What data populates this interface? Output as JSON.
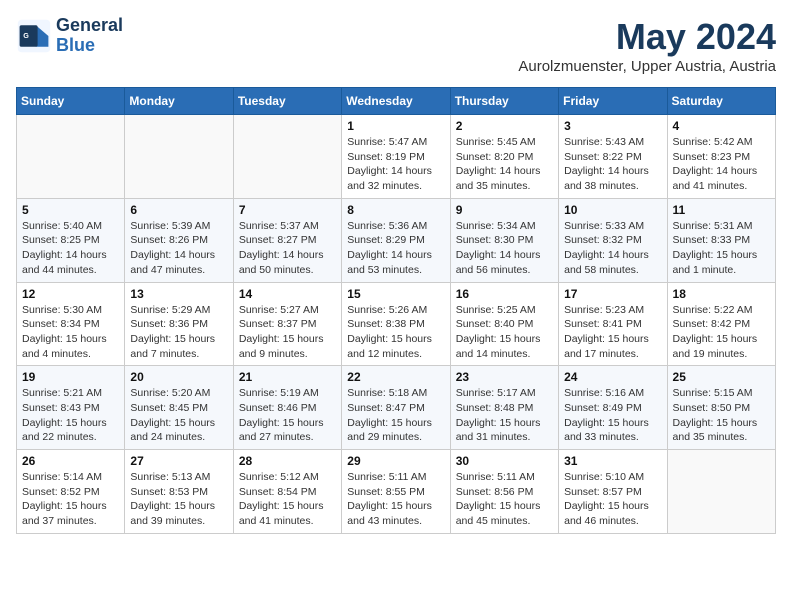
{
  "header": {
    "logo_line1": "General",
    "logo_line2": "Blue",
    "month": "May 2024",
    "location": "Aurolzmuenster, Upper Austria, Austria"
  },
  "weekdays": [
    "Sunday",
    "Monday",
    "Tuesday",
    "Wednesday",
    "Thursday",
    "Friday",
    "Saturday"
  ],
  "weeks": [
    [
      {
        "day": "",
        "info": ""
      },
      {
        "day": "",
        "info": ""
      },
      {
        "day": "",
        "info": ""
      },
      {
        "day": "1",
        "info": "Sunrise: 5:47 AM\nSunset: 8:19 PM\nDaylight: 14 hours and 32 minutes."
      },
      {
        "day": "2",
        "info": "Sunrise: 5:45 AM\nSunset: 8:20 PM\nDaylight: 14 hours and 35 minutes."
      },
      {
        "day": "3",
        "info": "Sunrise: 5:43 AM\nSunset: 8:22 PM\nDaylight: 14 hours and 38 minutes."
      },
      {
        "day": "4",
        "info": "Sunrise: 5:42 AM\nSunset: 8:23 PM\nDaylight: 14 hours and 41 minutes."
      }
    ],
    [
      {
        "day": "5",
        "info": "Sunrise: 5:40 AM\nSunset: 8:25 PM\nDaylight: 14 hours and 44 minutes."
      },
      {
        "day": "6",
        "info": "Sunrise: 5:39 AM\nSunset: 8:26 PM\nDaylight: 14 hours and 47 minutes."
      },
      {
        "day": "7",
        "info": "Sunrise: 5:37 AM\nSunset: 8:27 PM\nDaylight: 14 hours and 50 minutes."
      },
      {
        "day": "8",
        "info": "Sunrise: 5:36 AM\nSunset: 8:29 PM\nDaylight: 14 hours and 53 minutes."
      },
      {
        "day": "9",
        "info": "Sunrise: 5:34 AM\nSunset: 8:30 PM\nDaylight: 14 hours and 56 minutes."
      },
      {
        "day": "10",
        "info": "Sunrise: 5:33 AM\nSunset: 8:32 PM\nDaylight: 14 hours and 58 minutes."
      },
      {
        "day": "11",
        "info": "Sunrise: 5:31 AM\nSunset: 8:33 PM\nDaylight: 15 hours and 1 minute."
      }
    ],
    [
      {
        "day": "12",
        "info": "Sunrise: 5:30 AM\nSunset: 8:34 PM\nDaylight: 15 hours and 4 minutes."
      },
      {
        "day": "13",
        "info": "Sunrise: 5:29 AM\nSunset: 8:36 PM\nDaylight: 15 hours and 7 minutes."
      },
      {
        "day": "14",
        "info": "Sunrise: 5:27 AM\nSunset: 8:37 PM\nDaylight: 15 hours and 9 minutes."
      },
      {
        "day": "15",
        "info": "Sunrise: 5:26 AM\nSunset: 8:38 PM\nDaylight: 15 hours and 12 minutes."
      },
      {
        "day": "16",
        "info": "Sunrise: 5:25 AM\nSunset: 8:40 PM\nDaylight: 15 hours and 14 minutes."
      },
      {
        "day": "17",
        "info": "Sunrise: 5:23 AM\nSunset: 8:41 PM\nDaylight: 15 hours and 17 minutes."
      },
      {
        "day": "18",
        "info": "Sunrise: 5:22 AM\nSunset: 8:42 PM\nDaylight: 15 hours and 19 minutes."
      }
    ],
    [
      {
        "day": "19",
        "info": "Sunrise: 5:21 AM\nSunset: 8:43 PM\nDaylight: 15 hours and 22 minutes."
      },
      {
        "day": "20",
        "info": "Sunrise: 5:20 AM\nSunset: 8:45 PM\nDaylight: 15 hours and 24 minutes."
      },
      {
        "day": "21",
        "info": "Sunrise: 5:19 AM\nSunset: 8:46 PM\nDaylight: 15 hours and 27 minutes."
      },
      {
        "day": "22",
        "info": "Sunrise: 5:18 AM\nSunset: 8:47 PM\nDaylight: 15 hours and 29 minutes."
      },
      {
        "day": "23",
        "info": "Sunrise: 5:17 AM\nSunset: 8:48 PM\nDaylight: 15 hours and 31 minutes."
      },
      {
        "day": "24",
        "info": "Sunrise: 5:16 AM\nSunset: 8:49 PM\nDaylight: 15 hours and 33 minutes."
      },
      {
        "day": "25",
        "info": "Sunrise: 5:15 AM\nSunset: 8:50 PM\nDaylight: 15 hours and 35 minutes."
      }
    ],
    [
      {
        "day": "26",
        "info": "Sunrise: 5:14 AM\nSunset: 8:52 PM\nDaylight: 15 hours and 37 minutes."
      },
      {
        "day": "27",
        "info": "Sunrise: 5:13 AM\nSunset: 8:53 PM\nDaylight: 15 hours and 39 minutes."
      },
      {
        "day": "28",
        "info": "Sunrise: 5:12 AM\nSunset: 8:54 PM\nDaylight: 15 hours and 41 minutes."
      },
      {
        "day": "29",
        "info": "Sunrise: 5:11 AM\nSunset: 8:55 PM\nDaylight: 15 hours and 43 minutes."
      },
      {
        "day": "30",
        "info": "Sunrise: 5:11 AM\nSunset: 8:56 PM\nDaylight: 15 hours and 45 minutes."
      },
      {
        "day": "31",
        "info": "Sunrise: 5:10 AM\nSunset: 8:57 PM\nDaylight: 15 hours and 46 minutes."
      },
      {
        "day": "",
        "info": ""
      }
    ]
  ]
}
